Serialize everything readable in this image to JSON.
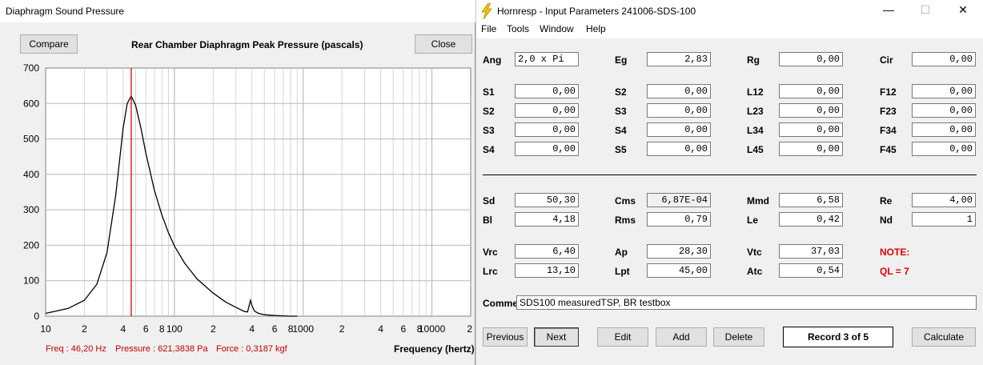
{
  "left_window": {
    "title": "Diaphragm Sound Pressure",
    "compare_label": "Compare",
    "close_label": "Close",
    "chart_title": "Rear Chamber Diaphragm Peak Pressure (pascals)",
    "readout": {
      "freq": "Freq : 46,20 Hz",
      "pressure": "Pressure : 621,3838 Pa",
      "force": "Force : 0,3187 kgf"
    },
    "xlabel": "Frequency (hertz)"
  },
  "chart_data": {
    "type": "line",
    "title": "Rear Chamber Diaphragm Peak Pressure (pascals)",
    "xlabel": "Frequency (hertz)",
    "ylabel": "",
    "x_scale": "log",
    "xlim": [
      10,
      20000
    ],
    "ylim": [
      0,
      700
    ],
    "yticks": [
      0,
      100,
      200,
      300,
      400,
      500,
      600,
      700
    ],
    "xtick_labels": [
      {
        "v": 10,
        "t": "10"
      },
      {
        "v": 20,
        "t": "2"
      },
      {
        "v": 40,
        "t": "4"
      },
      {
        "v": 60,
        "t": "6"
      },
      {
        "v": 80,
        "t": "8"
      },
      {
        "v": 100,
        "t": "100"
      },
      {
        "v": 200,
        "t": "2"
      },
      {
        "v": 400,
        "t": "4"
      },
      {
        "v": 600,
        "t": "6"
      },
      {
        "v": 800,
        "t": "8"
      },
      {
        "v": 1000,
        "t": "1000"
      },
      {
        "v": 2000,
        "t": "2"
      },
      {
        "v": 4000,
        "t": "4"
      },
      {
        "v": 6000,
        "t": "6"
      },
      {
        "v": 8000,
        "t": "8"
      },
      {
        "v": 10000,
        "t": "10000"
      },
      {
        "v": 20000,
        "t": "2"
      }
    ],
    "grid": true,
    "cursor_x": 46.2,
    "series": [
      {
        "x": [
          10,
          15,
          20,
          25,
          30,
          35,
          40,
          43,
          46.2,
          50,
          55,
          60,
          70,
          80,
          90,
          100,
          120,
          150,
          200,
          250,
          300,
          350,
          370,
          390,
          400,
          420,
          450,
          500,
          600,
          700,
          800,
          900
        ],
        "y": [
          8,
          22,
          45,
          90,
          180,
          340,
          530,
          600,
          621,
          595,
          530,
          460,
          355,
          285,
          235,
          198,
          150,
          105,
          65,
          40,
          25,
          13,
          12,
          45,
          30,
          14,
          8,
          4,
          2,
          1,
          0,
          0
        ]
      }
    ]
  },
  "right_window": {
    "title": "Hornresp - Input Parameters   241006-SDS-100",
    "controls": {
      "minimize": "—",
      "maximize": "☐",
      "close": "✕"
    },
    "menu": [
      "File",
      "Tools",
      "Window",
      "Help"
    ],
    "params_top": [
      {
        "label": "Ang",
        "value": "2,0 x Pi"
      },
      {
        "label": "Eg",
        "value": "2,83"
      },
      {
        "label": "Rg",
        "value": "0,00"
      },
      {
        "label": "Cir",
        "value": "0,00"
      }
    ],
    "params_grid": [
      [
        {
          "label": "S1",
          "value": "0,00"
        },
        {
          "label": "S2",
          "value": "0,00"
        },
        {
          "label": "L12",
          "value": "0,00"
        },
        {
          "label": "F12",
          "value": "0,00"
        }
      ],
      [
        {
          "label": "S2",
          "value": "0,00"
        },
        {
          "label": "S3",
          "value": "0,00"
        },
        {
          "label": "L23",
          "value": "0,00"
        },
        {
          "label": "F23",
          "value": "0,00"
        }
      ],
      [
        {
          "label": "S3",
          "value": "0,00"
        },
        {
          "label": "S4",
          "value": "0,00"
        },
        {
          "label": "L34",
          "value": "0,00"
        },
        {
          "label": "F34",
          "value": "0,00"
        }
      ],
      [
        {
          "label": "S4",
          "value": "0,00"
        },
        {
          "label": "S5",
          "value": "0,00"
        },
        {
          "label": "L45",
          "value": "0,00"
        },
        {
          "label": "F45",
          "value": "0,00"
        }
      ]
    ],
    "driver_rows": [
      [
        {
          "label": "Sd",
          "value": "50,30"
        },
        {
          "label": "Cms",
          "value": "6,87E-04"
        },
        {
          "label": "Mmd",
          "value": "6,58"
        },
        {
          "label": "Re",
          "value": "4,00"
        }
      ],
      [
        {
          "label": "Bl",
          "value": "4,18"
        },
        {
          "label": "Rms",
          "value": "0,79"
        },
        {
          "label": "Le",
          "value": "0,42"
        },
        {
          "label": "Nd",
          "value": "1"
        }
      ]
    ],
    "chamber_rows": [
      [
        {
          "label": "Vrc",
          "value": "6,40"
        },
        {
          "label": "Ap",
          "value": "28,30"
        },
        {
          "label": "Vtc",
          "value": "37,03"
        }
      ],
      [
        {
          "label": "Lrc",
          "value": "13,10"
        },
        {
          "label": "Lpt",
          "value": "45,00"
        },
        {
          "label": "Atc",
          "value": "0,54"
        }
      ]
    ],
    "note_label": "NOTE:",
    "ql_label": "QL = 7",
    "comment_label": "Comment",
    "comment_value": "SDS100 measuredTSP, BR testbox",
    "buttons": {
      "previous": "Previous",
      "next": "Next",
      "edit": "Edit",
      "add": "Add",
      "delete": "Delete",
      "calculate": "Calculate"
    },
    "record": "Record 3 of 5"
  },
  "colors": {
    "cursor": "#e00000",
    "readout": "#c00000",
    "note": "#e00000",
    "bolt": "#f2c200"
  }
}
